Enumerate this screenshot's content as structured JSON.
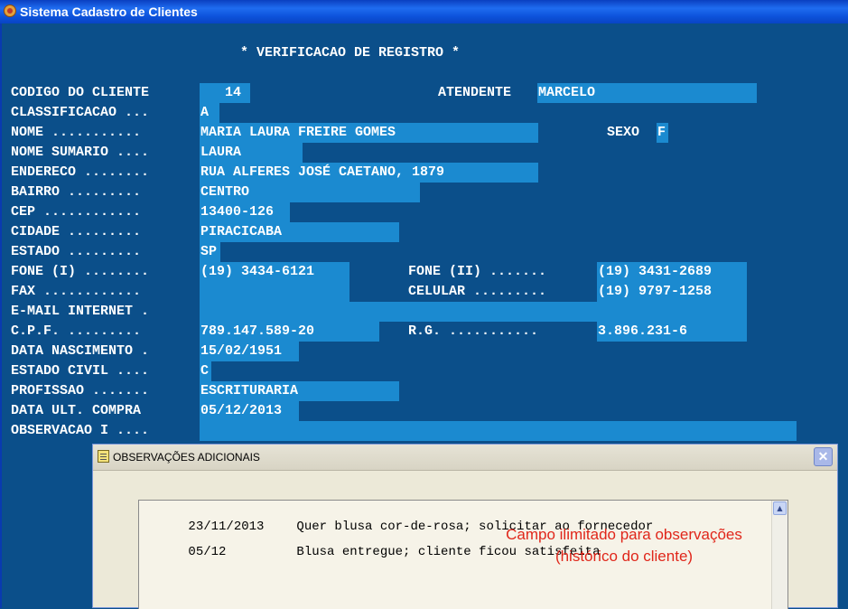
{
  "window": {
    "title": "Sistema Cadastro de Clientes"
  },
  "screen": {
    "heading": "* VERIFICACAO DE REGISTRO *",
    "fields": {
      "codigo": {
        "label": "CODIGO DO CLIENTE",
        "value": "   14"
      },
      "atendente": {
        "label": "ATENDENTE",
        "value": "MARCELO"
      },
      "classificacao": {
        "label": "CLASSIFICACAO ...",
        "value": "A"
      },
      "nome": {
        "label": "NOME ...........",
        "value": "MARIA LAURA FREIRE GOMES"
      },
      "sexo": {
        "label": "SEXO",
        "value": "F"
      },
      "nome_sumario": {
        "label": "NOME SUMARIO ....",
        "value": "LAURA"
      },
      "endereco": {
        "label": "ENDERECO ........",
        "value": "RUA ALFERES JOSÉ CAETANO, 1879"
      },
      "bairro": {
        "label": "BAIRRO .........",
        "value": "CENTRO"
      },
      "cep": {
        "label": "CEP ............",
        "value": "13400-126"
      },
      "cidade": {
        "label": "CIDADE .........",
        "value": "PIRACICABA"
      },
      "estado": {
        "label": "ESTADO .........",
        "value": "SP"
      },
      "fone1": {
        "label": "FONE (I) ........",
        "value": "(19) 3434-6121"
      },
      "fone2": {
        "label": "FONE (II) .......",
        "value": "(19) 3431-2689"
      },
      "fax": {
        "label": "FAX ............",
        "value": ""
      },
      "celular": {
        "label": "CELULAR .........",
        "value": "(19) 9797-1258"
      },
      "email": {
        "label": "E-MAIL INTERNET .",
        "value": ""
      },
      "cpf": {
        "label": "C.P.F. .........",
        "value": "789.147.589-20"
      },
      "rg": {
        "label": "R.G. ...........",
        "value": "3.896.231-6"
      },
      "nascimento": {
        "label": "DATA NASCIMENTO .",
        "value": "15/02/1951"
      },
      "estado_civil": {
        "label": "ESTADO CIVIL ....",
        "value": "C"
      },
      "profissao": {
        "label": "PROFISSAO .......",
        "value": "ESCRITURARIA"
      },
      "ult_compra": {
        "label": "DATA ULT. COMPRA",
        "value": "05/12/2013"
      },
      "observacao": {
        "label": "OBSERVACAO I ....",
        "value": ""
      }
    }
  },
  "dialog": {
    "title": "OBSERVAÇÕES ADICIONAIS",
    "close_label": "✕",
    "entries": [
      {
        "date": "23/11/2013",
        "text": "Quer blusa cor-de-rosa; solicitar ao fornecedor"
      },
      {
        "date": "05/12",
        "text": "Blusa entregue; cliente ficou satisfeita"
      }
    ],
    "annotation_line1": "Campo ilimitado para observações",
    "annotation_line2": "(histórico do cliente)"
  }
}
